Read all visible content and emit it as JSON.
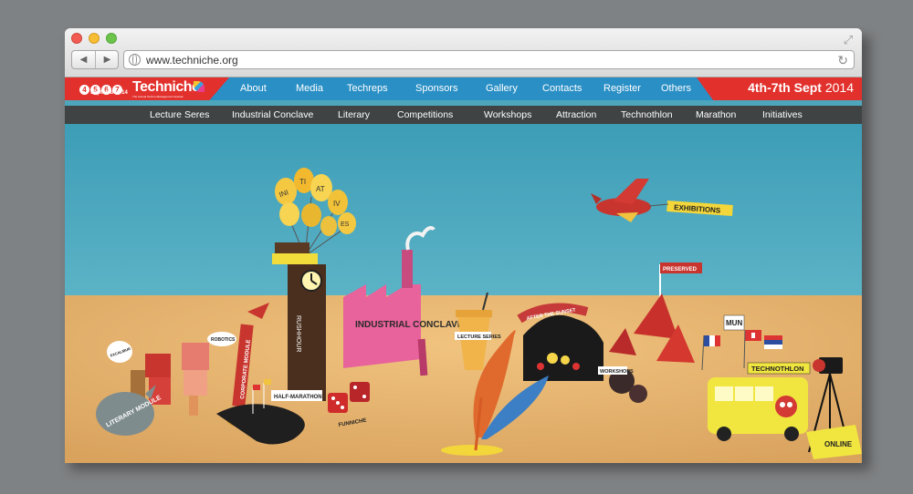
{
  "browser": {
    "url": "www.techniche.org",
    "back_icon": "back-arrow-icon",
    "forward_icon": "forward-arrow-icon",
    "reload_icon": "reload-icon",
    "expand_icon": "expand-icon"
  },
  "logo": {
    "days": [
      "4",
      "5",
      "6",
      "7"
    ],
    "month": "September '14",
    "name": "Techniche",
    "tagline": "The Annual Techno-Management Festival"
  },
  "nav": {
    "items": [
      "About",
      "Media",
      "Techreps",
      "Sponsors",
      "Gallery",
      "Contacts",
      "Register",
      "Others"
    ]
  },
  "event_dates": {
    "range": "4th-7th Sept",
    "year": "2014"
  },
  "subnav": {
    "items": [
      "Lecture Seres",
      "Industrial Conclave",
      "Literary",
      "Competitions",
      "Workshops",
      "Attraction",
      "Technothlon",
      "Marathon",
      "Initiatives"
    ]
  },
  "scene": {
    "balloons_word": [
      "INI",
      "TI",
      "AT",
      "IV",
      "ES"
    ],
    "labels": {
      "exhibitions": "EXHIBITIONS",
      "preserved": "PRESERVED",
      "after_sunset": "AFTER THE SUNSET",
      "lecture_series": "LECTURE SERIES",
      "industrial_conclave": "INDUSTRIAL CONCLAVE",
      "rushhour": "RUSHHOUR",
      "robotics": "ROBOTICS",
      "corporate_module": "CORPORATE MODULE",
      "half_marathon": "HALF-MARATHON",
      "funniche": "FUNNICHE",
      "literary_module": "LITERARY MODULE",
      "workshops": "WORKSHOPS",
      "mun": "MUN",
      "technothlon": "TECHNOTHLON",
      "online": "ONLINE",
      "exhaust": "EXCALIBUR"
    }
  },
  "colors": {
    "header_blue": "#2a8fc5",
    "accent_red": "#e2302c",
    "subnav_dark": "#3f4344",
    "sky": "#4ea6bd",
    "table": "#e8b872"
  }
}
